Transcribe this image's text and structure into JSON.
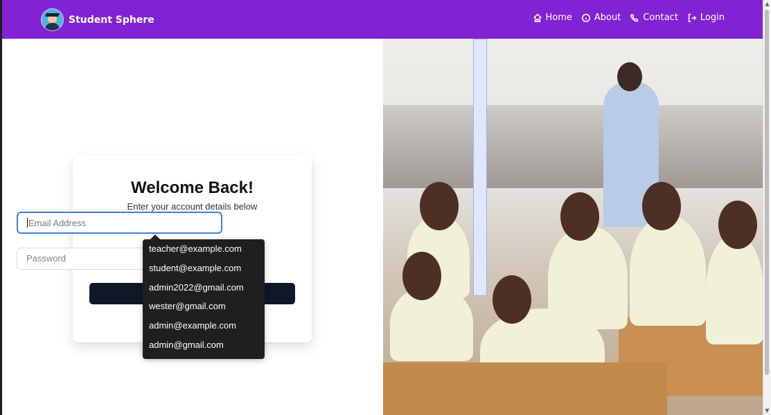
{
  "app": {
    "brand_name": "Student Sphere"
  },
  "navigation": {
    "items": [
      {
        "label": "Home",
        "icon": "home-icon"
      },
      {
        "label": "About",
        "icon": "info-icon"
      },
      {
        "label": "Contact",
        "icon": "phone-icon"
      },
      {
        "label": "Login",
        "icon": "login-icon"
      }
    ]
  },
  "login": {
    "title": "Welcome Back!",
    "subtitle": "Enter your account details below",
    "email_placeholder": "Email Address",
    "password_placeholder": "Password"
  },
  "autocomplete": {
    "suggestions": [
      "teacher@example.com",
      "student@example.com",
      "admin2022@gmail.com",
      "wester@gmail.com",
      "admin@example.com",
      "admin@gmail.com"
    ]
  },
  "colors": {
    "navbar": "#8122d4",
    "primary_button": "#101828",
    "focus_border": "#3d7fde",
    "dropdown": "#1f1f1f"
  }
}
